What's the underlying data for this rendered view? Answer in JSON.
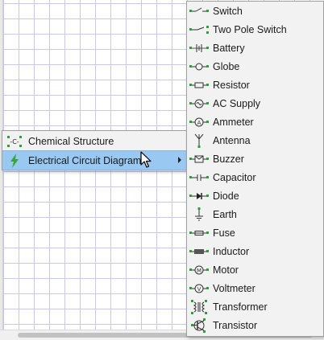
{
  "main_menu": {
    "items": [
      {
        "label": "Chemical Structure",
        "icon": "chemical-structure-icon"
      },
      {
        "label": "Electrical Circuit Diagram",
        "icon": "lightning-icon"
      }
    ]
  },
  "submenu": {
    "items": [
      {
        "label": "Switch",
        "icon": "switch-icon"
      },
      {
        "label": "Two Pole Switch",
        "icon": "two-pole-switch-icon"
      },
      {
        "label": "Battery",
        "icon": "battery-icon"
      },
      {
        "label": "Globe",
        "icon": "globe-icon"
      },
      {
        "label": "Resistor",
        "icon": "resistor-icon"
      },
      {
        "label": "AC Supply",
        "icon": "ac-supply-icon"
      },
      {
        "label": "Ammeter",
        "icon": "ammeter-icon"
      },
      {
        "label": "Antenna",
        "icon": "antenna-icon"
      },
      {
        "label": "Buzzer",
        "icon": "buzzer-icon"
      },
      {
        "label": "Capacitor",
        "icon": "capacitor-icon"
      },
      {
        "label": "Diode",
        "icon": "diode-icon"
      },
      {
        "label": "Earth",
        "icon": "earth-icon"
      },
      {
        "label": "Fuse",
        "icon": "fuse-icon"
      },
      {
        "label": "Inductor",
        "icon": "inductor-icon"
      },
      {
        "label": "Motor",
        "icon": "motor-icon"
      },
      {
        "label": "Voltmeter",
        "icon": "voltmeter-icon"
      },
      {
        "label": "Transformer",
        "icon": "transformer-icon"
      },
      {
        "label": "Transistor",
        "icon": "transistor-icon"
      }
    ]
  },
  "colors": {
    "highlight": "#99c9f2",
    "menu_bg": "#f2f2f2",
    "grid": "#c8c8e8",
    "icon_green": "#2e9e3a"
  }
}
